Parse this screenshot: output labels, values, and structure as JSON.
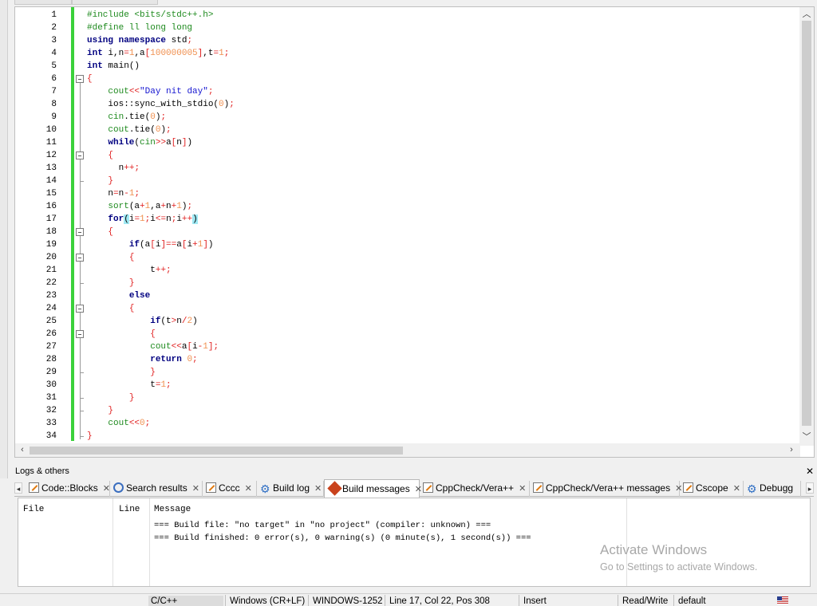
{
  "editor": {
    "line_numbers": [
      "1",
      "2",
      "3",
      "4",
      "5",
      "6",
      "7",
      "8",
      "9",
      "10",
      "11",
      "12",
      "13",
      "14",
      "15",
      "16",
      "17",
      "18",
      "19",
      "20",
      "21",
      "22",
      "23",
      "24",
      "25",
      "26",
      "27",
      "28",
      "29",
      "30",
      "31",
      "32",
      "33",
      "34"
    ],
    "code": [
      "#include <bits/stdc++.h>",
      "#define ll long long",
      "using namespace std;",
      "int i,n=1,a[100000005],t=1;",
      "int main()",
      "{",
      "    cout<<\"Day nit day\";",
      "    ios::sync_with_stdio(0);",
      "    cin.tie(0);",
      "    cout.tie(0);",
      "    while(cin>>a[n])",
      "    {",
      "      n++;",
      "    }",
      "    n=n-1;",
      "    sort(a+1,a+n+1);",
      "    for(i=1;i<=n;i++)",
      "    {",
      "        if(a[i]==a[i+1])",
      "        {",
      "            t++;",
      "        }",
      "        else",
      "        {",
      "            if(t>n/2)",
      "            {",
      "            cout<<a[i-1];",
      "            return 0;",
      "            }",
      "            t=1;",
      "        }",
      "    }",
      "    cout<<0;",
      "}"
    ]
  },
  "logs_panel": {
    "title": "Logs & others",
    "close_glyph": "✕",
    "tabs": [
      {
        "label": "Code::Blocks",
        "icon": "pencil-icon"
      },
      {
        "label": "Search results",
        "icon": "search-icon"
      },
      {
        "label": "Cccc",
        "icon": "pencil-icon"
      },
      {
        "label": "Build log",
        "icon": "gear-icon"
      },
      {
        "label": "Build messages",
        "icon": "diamond-icon",
        "active": true
      },
      {
        "label": "CppCheck/Vera++",
        "icon": "pencil-icon"
      },
      {
        "label": "CppCheck/Vera++ messages",
        "icon": "pencil-icon"
      },
      {
        "label": "Cscope",
        "icon": "pencil-icon"
      },
      {
        "label": "Debugg",
        "icon": "gear-icon"
      }
    ],
    "columns": [
      "File",
      "Line",
      "Message"
    ],
    "messages": [
      "=== Build file: \"no target\" in \"no project\" (compiler: unknown) ===",
      "=== Build finished: 0 error(s), 0 warning(s) (0 minute(s), 1 second(s)) ==="
    ]
  },
  "watermark": {
    "line1": "Activate Windows",
    "line2": "Go to Settings to activate Windows."
  },
  "status_bar": {
    "language": "C/C++",
    "line_endings": "Windows (CR+LF)",
    "encoding": "WINDOWS-1252",
    "position": "Line 17, Col 22, Pos 308",
    "mode": "Insert",
    "access": "Read/Write",
    "profile": "default"
  }
}
